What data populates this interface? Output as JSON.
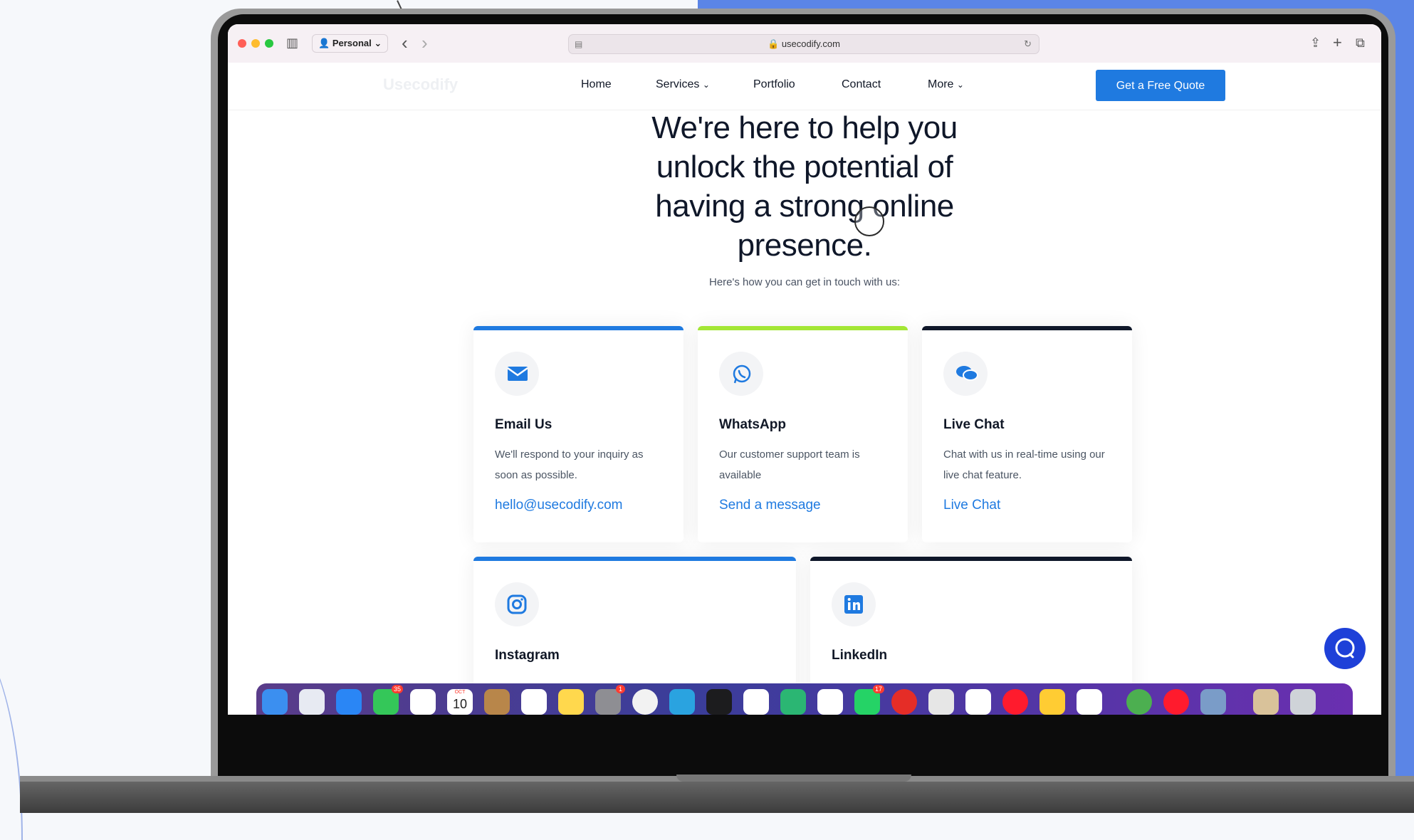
{
  "browser": {
    "profile_label": "Personal",
    "url": "usecodify.com",
    "back_icon": "‹",
    "forward_icon": "›",
    "share_icon": "⇪",
    "newtab_icon": "+",
    "tabs_icon": "⧉",
    "sidebar_icon": "▥"
  },
  "nav": {
    "logo": "Usecodify",
    "items": [
      "Home",
      "Services",
      "Portfolio",
      "Contact",
      "More"
    ],
    "cta": "Get a Free Quote"
  },
  "hero": {
    "headline_lines": [
      "We're here to help you",
      "unlock the potential of",
      "having a strong online",
      "presence."
    ],
    "subtitle": "Here's how you can get in touch with us:"
  },
  "cards": [
    {
      "title": "Email Us",
      "desc": "We'll respond to your inquiry as soon as possible.",
      "link": "hello@usecodify.com",
      "accent": "#1f7ae0",
      "icon": "envelope-icon"
    },
    {
      "title": "WhatsApp",
      "desc": "Our customer support team is available",
      "link": "Send a message",
      "accent": "#a3e635",
      "icon": "whatsapp-icon"
    },
    {
      "title": "Live Chat",
      "desc": "Chat with us in real-time using our live chat feature.",
      "link": "Live Chat",
      "accent": "#0f1729",
      "icon": "chat-bubbles-icon"
    },
    {
      "title": "Instagram",
      "accent": "#1f7ae0",
      "icon": "instagram-icon"
    },
    {
      "title": "LinkedIn",
      "accent": "#0f1729",
      "icon": "linkedin-icon"
    }
  ],
  "dock": {
    "badges": [
      "35",
      "1",
      "17"
    ],
    "calendar_month": "OCT",
    "calendar_day": "10"
  },
  "colors": {
    "primary": "#1f7ae0",
    "background_blue": "#5b85e6"
  }
}
